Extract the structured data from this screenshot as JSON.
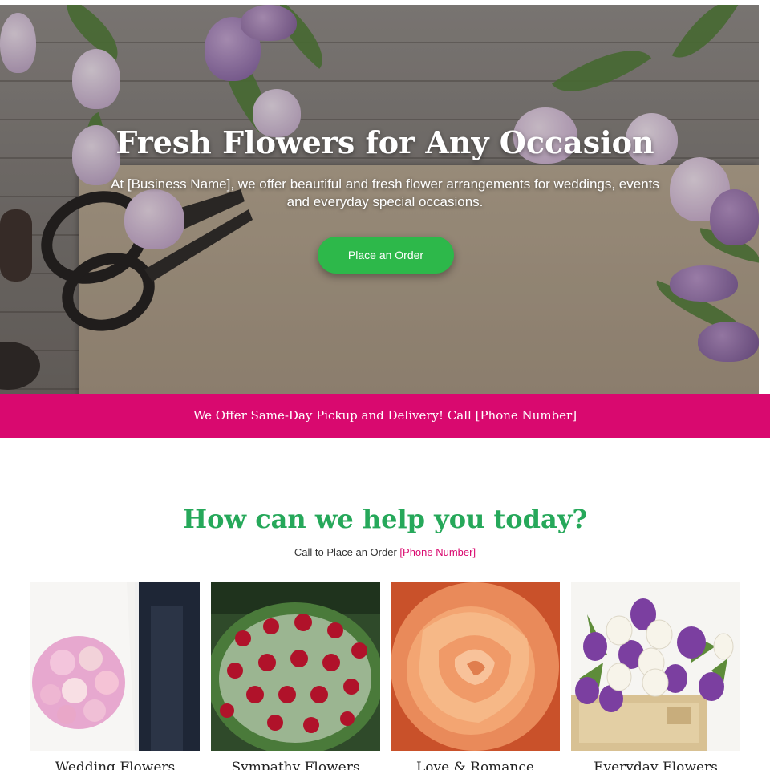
{
  "hero": {
    "title": "Fresh Flowers for Any Occasion",
    "subtitle": "At [Business Name], we offer beautiful and fresh flower arrangements for weddings, events and everyday special occasions.",
    "cta_label": "Place an Order"
  },
  "banner": {
    "text": "We Offer Same-Day Pickup and Delivery! Call [Phone Number]"
  },
  "help": {
    "title": "How can we help you today?",
    "call_text": "Call to Place an Order",
    "phone": "[Phone Number]"
  },
  "cards": [
    {
      "label": "Wedding Flowers",
      "image": "bridal-bouquet-image"
    },
    {
      "label": "Sympathy Flowers",
      "image": "red-roses-arrangement-image"
    },
    {
      "label": "Love & Romance",
      "image": "orange-rose-image"
    },
    {
      "label": "Everyday Flowers",
      "image": "tulips-in-crate-image"
    }
  ],
  "colors": {
    "accent_green": "#2db84a",
    "heading_green": "#26a85a",
    "brand_pink": "#d9096f"
  }
}
